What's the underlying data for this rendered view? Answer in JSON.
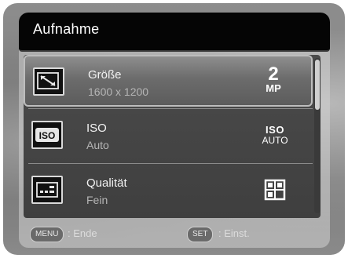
{
  "menu": {
    "title": "Aufnahme"
  },
  "items": [
    {
      "icon": "image-size-icon",
      "label": "Größe",
      "value": "1600 x 1200",
      "indicator_text_top": "2",
      "indicator_text_bottom": "MP",
      "selected": true
    },
    {
      "icon": "iso-icon",
      "label": "ISO",
      "value": "Auto",
      "indicator_text_top": "ISO",
      "indicator_text_bottom": "AUTO",
      "selected": false
    },
    {
      "icon": "quality-icon",
      "label": "Qualität",
      "value": "Fein",
      "indicator_text_top": "",
      "indicator_text_bottom": "",
      "selected": false
    }
  ],
  "footer": {
    "menu_key": "MENU",
    "menu_label": ": Ende",
    "set_key": "SET",
    "set_label": ": Einst."
  },
  "colors": {
    "title_bar": "#050505",
    "list_bg": "#434343",
    "selected_bg": "#7a7a7a",
    "text": "#f2f2f2",
    "value_text": "#b5b5b5"
  }
}
